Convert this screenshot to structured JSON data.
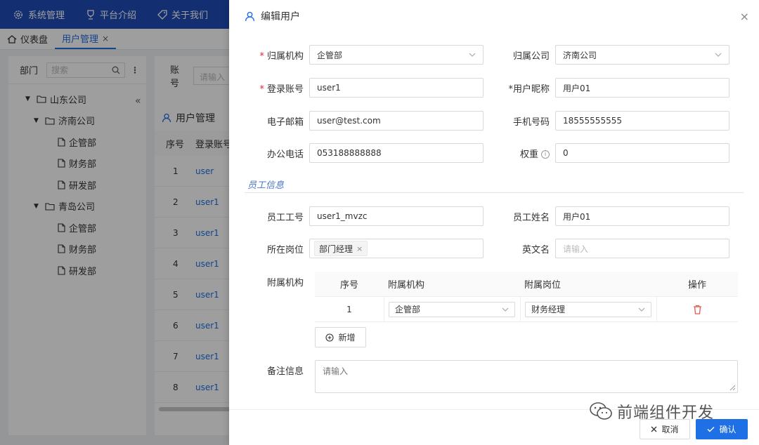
{
  "topnav": {
    "items": [
      {
        "label": "系统管理",
        "icon": "gear-icon"
      },
      {
        "label": "平台介绍",
        "icon": "trophy-icon"
      },
      {
        "label": "关于我们",
        "icon": "tag-icon"
      }
    ]
  },
  "tabs": [
    {
      "label": "仪表盘",
      "icon": "home-icon"
    },
    {
      "label": "用户管理",
      "close": "×"
    }
  ],
  "leftpanel": {
    "title": "部门",
    "search_placeholder": "搜索",
    "tree": [
      {
        "label": "山东公司",
        "level": 0,
        "type": "folder",
        "expanded": true
      },
      {
        "label": "济南公司",
        "level": 1,
        "type": "folder",
        "expanded": true
      },
      {
        "label": "企管部",
        "level": 2,
        "type": "file"
      },
      {
        "label": "财务部",
        "level": 2,
        "type": "file"
      },
      {
        "label": "研发部",
        "level": 2,
        "type": "file"
      },
      {
        "label": "青岛公司",
        "level": 1,
        "type": "folder",
        "expanded": true
      },
      {
        "label": "企管部",
        "level": 2,
        "type": "file"
      },
      {
        "label": "财务部",
        "level": 2,
        "type": "file"
      },
      {
        "label": "研发部",
        "level": 2,
        "type": "file"
      }
    ]
  },
  "mainbg": {
    "filter_label": "账号",
    "filter_placeholder": "请输入",
    "title": "用户管理",
    "col_index": "序号",
    "col_account": "登录账号",
    "rows": [
      {
        "n": "1",
        "u": "user"
      },
      {
        "n": "2",
        "u": "user1"
      },
      {
        "n": "3",
        "u": "user1"
      },
      {
        "n": "4",
        "u": "user1"
      },
      {
        "n": "5",
        "u": "user1"
      },
      {
        "n": "6",
        "u": "user1"
      },
      {
        "n": "7",
        "u": "user1"
      },
      {
        "n": "8",
        "u": "user1"
      }
    ]
  },
  "drawer": {
    "title": "编辑用户",
    "close": "×",
    "fields": {
      "org": {
        "label": "归属机构",
        "value": "企管部",
        "required": true
      },
      "company": {
        "label": "归属公司",
        "value": "济南公司"
      },
      "account": {
        "label": "登录账号",
        "value": "user1",
        "required": true
      },
      "nickname": {
        "label": "用户昵称",
        "value": "用户01",
        "required": true
      },
      "email": {
        "label": "电子邮箱",
        "value": "user@test.com"
      },
      "phone": {
        "label": "手机号码",
        "value": "18555555555"
      },
      "office_phone": {
        "label": "办公电话",
        "value": "053188888888"
      },
      "weight": {
        "label": "权重",
        "value": "0",
        "info": "i"
      }
    },
    "section_title": "员工信息",
    "employee": {
      "emp_no": {
        "label": "员工工号",
        "value": "user1_mvzc"
      },
      "emp_name": {
        "label": "员工姓名",
        "value": "用户01"
      },
      "post": {
        "label": "所在岗位",
        "tag": "部门经理",
        "tag_close": "×"
      },
      "en_name": {
        "label": "英文名",
        "placeholder": "请输入"
      }
    },
    "sub_org": {
      "label": "附属机构",
      "headers": [
        "序号",
        "附属机构",
        "附属岗位",
        "操作"
      ],
      "rows": [
        {
          "index": "1",
          "org": "企管部",
          "post": "财务经理"
        }
      ],
      "add_label": "新增"
    },
    "remark": {
      "label": "备注信息",
      "placeholder": "请输入"
    },
    "cancel_label": "取消",
    "ok_label": "确认"
  },
  "watermark": {
    "text": "前端组件开发"
  },
  "colors": {
    "nav": "#1f4db8",
    "accent": "#1f6fe5",
    "required": "#e23333",
    "section": "#4a74c9",
    "delete": "#e05a4f"
  }
}
